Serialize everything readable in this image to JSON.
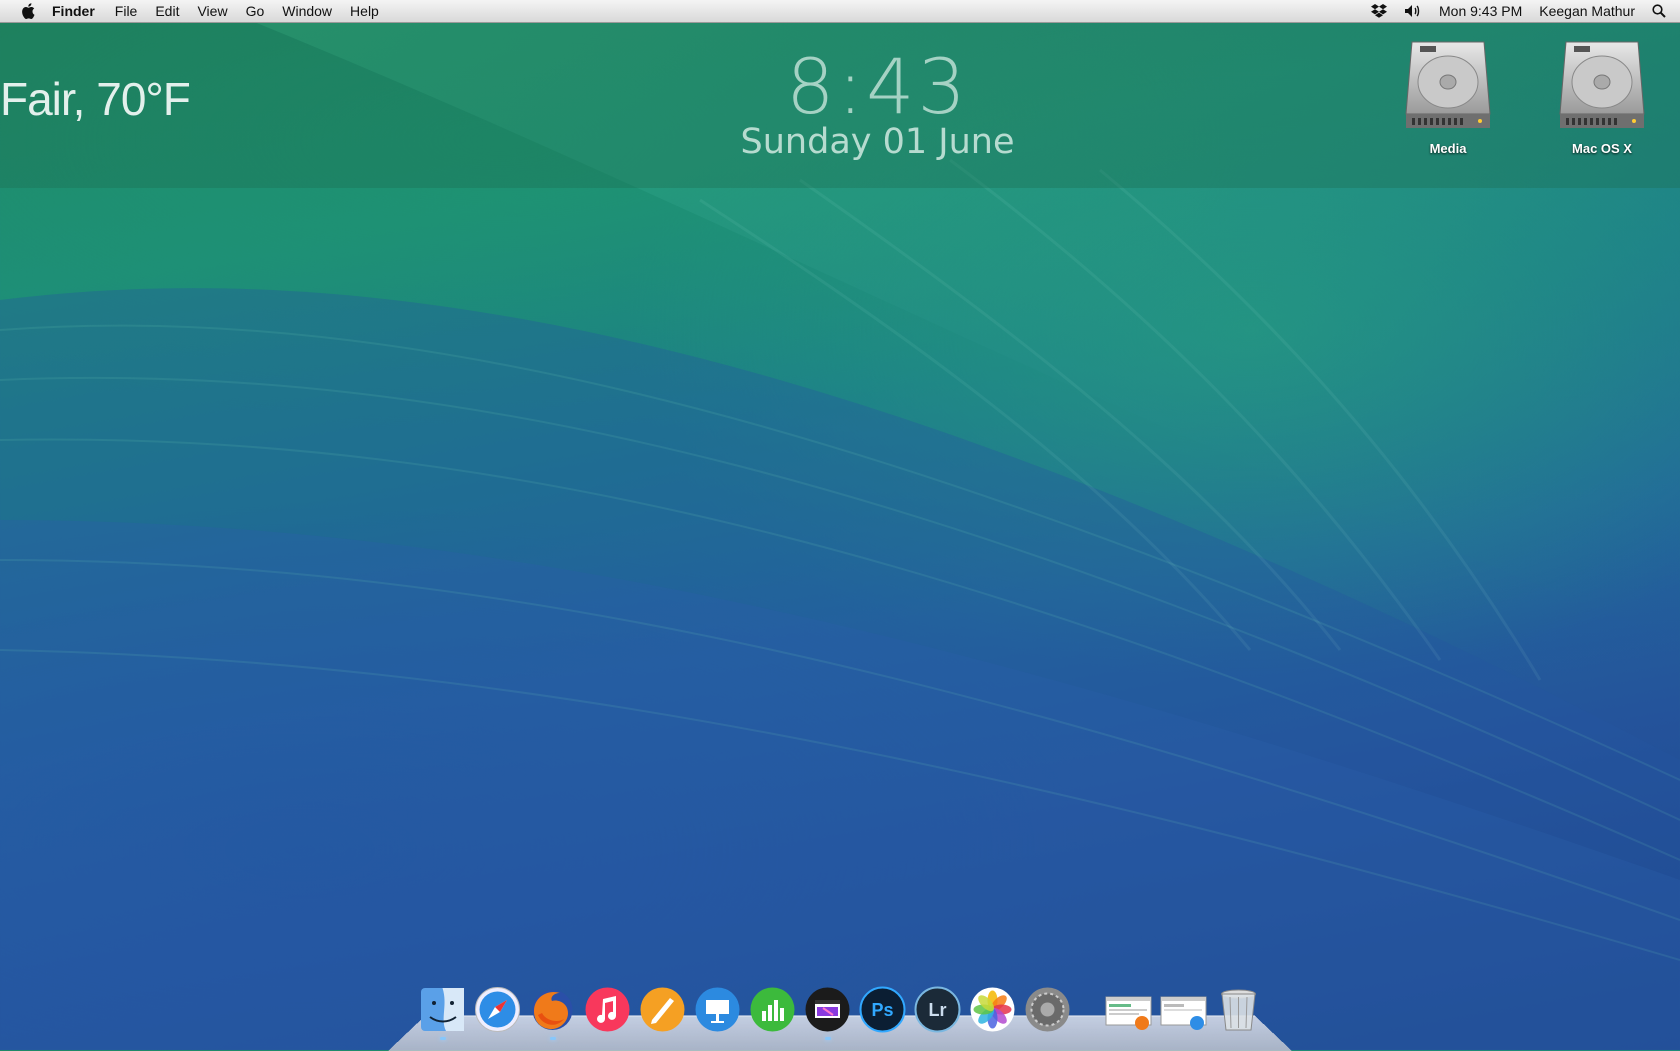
{
  "menubar": {
    "app_name": "Finder",
    "menus": [
      "File",
      "Edit",
      "View",
      "Go",
      "Window",
      "Help"
    ],
    "status": {
      "clock": "Mon 9:43 PM",
      "user": "Keegan Mathur",
      "icons": [
        "dropbox-icon",
        "volume-icon",
        "spotlight-search-icon"
      ]
    }
  },
  "desktop_widgets": {
    "weather": "Fair, 70°F",
    "time": "8:43",
    "date": "Sunday 01 June"
  },
  "desktop_icons": [
    {
      "label": "Media",
      "icon": "hard-drive-icon"
    },
    {
      "label": "Mac OS X",
      "icon": "hard-drive-icon"
    }
  ],
  "dock": {
    "apps": [
      "finder",
      "safari",
      "firefox",
      "itunes",
      "pages",
      "keynote",
      "numbers",
      "final-cut-pro",
      "photoshop",
      "lightroom",
      "photos",
      "system-preferences"
    ],
    "minimized": [
      "firefox-window",
      "safari-window"
    ],
    "trash": "trash"
  },
  "colors": {
    "menubar": "#e6e6e6",
    "wallpaper_green": "#1f8a63",
    "wallpaper_blue": "#24539b"
  }
}
